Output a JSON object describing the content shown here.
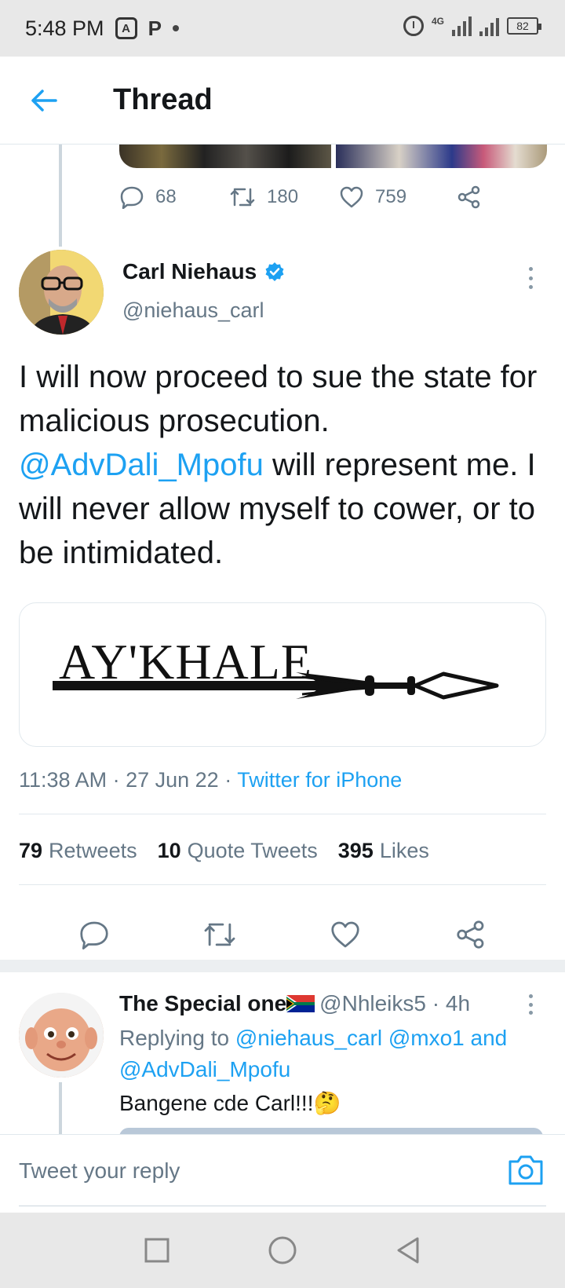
{
  "status_bar": {
    "time": "5:48 PM",
    "network": "4G",
    "battery": "82"
  },
  "header": {
    "title": "Thread"
  },
  "previous_tweet": {
    "reply_count": "68",
    "retweet_count": "180",
    "like_count": "759"
  },
  "tweet": {
    "author_name": "Carl Niehaus",
    "author_handle": "@niehaus_carl",
    "text_part1": "I will now proceed to sue the state for malicious prosecution. ",
    "mention": "@AdvDali_Mpofu",
    "text_part2": " will represent me. I  will never allow myself to cower, or to be intimidated.",
    "card_text": "AY'KHALE",
    "time": "11:38 AM",
    "date": "27 Jun 22",
    "source": "Twitter for iPhone",
    "retweets_count": "79",
    "retweets_label": "Retweets",
    "quote_count": "10",
    "quote_label": "Quote Tweets",
    "likes_count": "395",
    "likes_label": "Likes"
  },
  "reply": {
    "name": "The Special one",
    "handle": "@Nhleiks5",
    "age": "4h",
    "replying_label": "Replying to",
    "replying_mentions": "@niehaus_carl @mxo1",
    "replying_and": "and",
    "replying_last": "@AdvDali_Mpofu",
    "text": "Bangene cde Carl!!!🤔"
  },
  "composer": {
    "placeholder": "Tweet your reply"
  },
  "colors": {
    "accent": "#1da1f2",
    "secondary_text": "#657786",
    "primary_text": "#14171a"
  }
}
